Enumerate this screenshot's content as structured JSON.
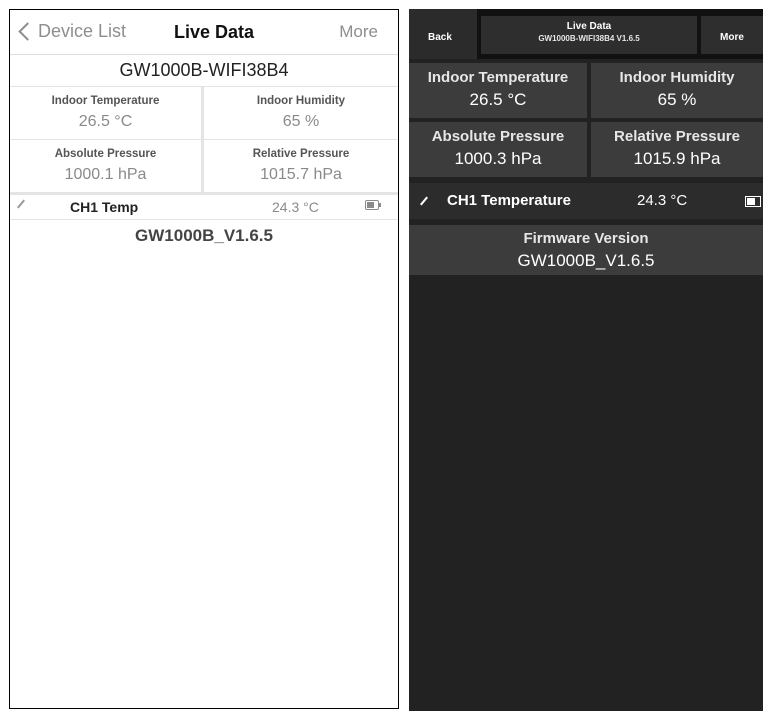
{
  "ios": {
    "nav": {
      "back_label": "Device List",
      "title": "Live Data",
      "more_label": "More"
    },
    "device_name": "GW1000B-WIFI38B4",
    "readings": [
      {
        "label": "Indoor Temperature",
        "value": "26.5 °C"
      },
      {
        "label": "Indoor Humidity",
        "value": "65 %"
      },
      {
        "label": "Absolute Pressure",
        "value": "1000.1 hPa"
      },
      {
        "label": "Relative Pressure",
        "value": "1015.7 hPa"
      }
    ],
    "sensor": {
      "name": "CH1 Temp",
      "value": "24.3 °C",
      "battery_icon": "battery-icon",
      "edit_icon": "pencil-icon"
    },
    "firmware": "GW1000B_V1.6.5"
  },
  "android": {
    "bar": {
      "back_label": "Back",
      "title": "Live Data",
      "subtitle": "GW1000B-WIFI38B4 V1.6.5",
      "more_label": "More"
    },
    "readings": [
      {
        "label": "Indoor Temperature",
        "value": "26.5 °C"
      },
      {
        "label": "Indoor Humidity",
        "value": "65 %"
      },
      {
        "label": "Absolute Pressure",
        "value": "1000.3 hPa"
      },
      {
        "label": "Relative Pressure",
        "value": "1015.9 hPa"
      }
    ],
    "sensor": {
      "name": "CH1 Temperature",
      "value": "24.3 °C",
      "battery_icon": "battery-icon",
      "edit_icon": "pencil-icon"
    },
    "firmware": {
      "label": "Firmware Version",
      "value": "GW1000B_V1.6.5"
    }
  },
  "colors": {
    "android_bg": "#222222",
    "android_tile": "#3c3c3c",
    "ios_secondary_text": "#8e8e8e"
  }
}
